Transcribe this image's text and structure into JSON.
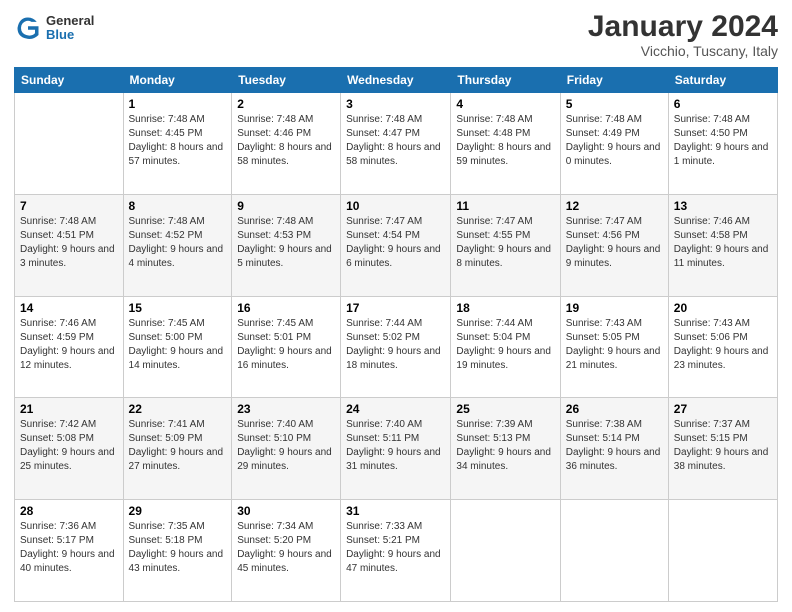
{
  "header": {
    "logo": {
      "general": "General",
      "blue": "Blue"
    },
    "title": "January 2024",
    "location": "Vicchio, Tuscany, Italy"
  },
  "weekdays": [
    "Sunday",
    "Monday",
    "Tuesday",
    "Wednesday",
    "Thursday",
    "Friday",
    "Saturday"
  ],
  "weeks": [
    [
      {
        "day": "",
        "sunrise": "",
        "sunset": "",
        "daylight": ""
      },
      {
        "day": "1",
        "sunrise": "Sunrise: 7:48 AM",
        "sunset": "Sunset: 4:45 PM",
        "daylight": "Daylight: 8 hours and 57 minutes."
      },
      {
        "day": "2",
        "sunrise": "Sunrise: 7:48 AM",
        "sunset": "Sunset: 4:46 PM",
        "daylight": "Daylight: 8 hours and 58 minutes."
      },
      {
        "day": "3",
        "sunrise": "Sunrise: 7:48 AM",
        "sunset": "Sunset: 4:47 PM",
        "daylight": "Daylight: 8 hours and 58 minutes."
      },
      {
        "day": "4",
        "sunrise": "Sunrise: 7:48 AM",
        "sunset": "Sunset: 4:48 PM",
        "daylight": "Daylight: 8 hours and 59 minutes."
      },
      {
        "day": "5",
        "sunrise": "Sunrise: 7:48 AM",
        "sunset": "Sunset: 4:49 PM",
        "daylight": "Daylight: 9 hours and 0 minutes."
      },
      {
        "day": "6",
        "sunrise": "Sunrise: 7:48 AM",
        "sunset": "Sunset: 4:50 PM",
        "daylight": "Daylight: 9 hours and 1 minute."
      }
    ],
    [
      {
        "day": "7",
        "sunrise": "Sunrise: 7:48 AM",
        "sunset": "Sunset: 4:51 PM",
        "daylight": "Daylight: 9 hours and 3 minutes."
      },
      {
        "day": "8",
        "sunrise": "Sunrise: 7:48 AM",
        "sunset": "Sunset: 4:52 PM",
        "daylight": "Daylight: 9 hours and 4 minutes."
      },
      {
        "day": "9",
        "sunrise": "Sunrise: 7:48 AM",
        "sunset": "Sunset: 4:53 PM",
        "daylight": "Daylight: 9 hours and 5 minutes."
      },
      {
        "day": "10",
        "sunrise": "Sunrise: 7:47 AM",
        "sunset": "Sunset: 4:54 PM",
        "daylight": "Daylight: 9 hours and 6 minutes."
      },
      {
        "day": "11",
        "sunrise": "Sunrise: 7:47 AM",
        "sunset": "Sunset: 4:55 PM",
        "daylight": "Daylight: 9 hours and 8 minutes."
      },
      {
        "day": "12",
        "sunrise": "Sunrise: 7:47 AM",
        "sunset": "Sunset: 4:56 PM",
        "daylight": "Daylight: 9 hours and 9 minutes."
      },
      {
        "day": "13",
        "sunrise": "Sunrise: 7:46 AM",
        "sunset": "Sunset: 4:58 PM",
        "daylight": "Daylight: 9 hours and 11 minutes."
      }
    ],
    [
      {
        "day": "14",
        "sunrise": "Sunrise: 7:46 AM",
        "sunset": "Sunset: 4:59 PM",
        "daylight": "Daylight: 9 hours and 12 minutes."
      },
      {
        "day": "15",
        "sunrise": "Sunrise: 7:45 AM",
        "sunset": "Sunset: 5:00 PM",
        "daylight": "Daylight: 9 hours and 14 minutes."
      },
      {
        "day": "16",
        "sunrise": "Sunrise: 7:45 AM",
        "sunset": "Sunset: 5:01 PM",
        "daylight": "Daylight: 9 hours and 16 minutes."
      },
      {
        "day": "17",
        "sunrise": "Sunrise: 7:44 AM",
        "sunset": "Sunset: 5:02 PM",
        "daylight": "Daylight: 9 hours and 18 minutes."
      },
      {
        "day": "18",
        "sunrise": "Sunrise: 7:44 AM",
        "sunset": "Sunset: 5:04 PM",
        "daylight": "Daylight: 9 hours and 19 minutes."
      },
      {
        "day": "19",
        "sunrise": "Sunrise: 7:43 AM",
        "sunset": "Sunset: 5:05 PM",
        "daylight": "Daylight: 9 hours and 21 minutes."
      },
      {
        "day": "20",
        "sunrise": "Sunrise: 7:43 AM",
        "sunset": "Sunset: 5:06 PM",
        "daylight": "Daylight: 9 hours and 23 minutes."
      }
    ],
    [
      {
        "day": "21",
        "sunrise": "Sunrise: 7:42 AM",
        "sunset": "Sunset: 5:08 PM",
        "daylight": "Daylight: 9 hours and 25 minutes."
      },
      {
        "day": "22",
        "sunrise": "Sunrise: 7:41 AM",
        "sunset": "Sunset: 5:09 PM",
        "daylight": "Daylight: 9 hours and 27 minutes."
      },
      {
        "day": "23",
        "sunrise": "Sunrise: 7:40 AM",
        "sunset": "Sunset: 5:10 PM",
        "daylight": "Daylight: 9 hours and 29 minutes."
      },
      {
        "day": "24",
        "sunrise": "Sunrise: 7:40 AM",
        "sunset": "Sunset: 5:11 PM",
        "daylight": "Daylight: 9 hours and 31 minutes."
      },
      {
        "day": "25",
        "sunrise": "Sunrise: 7:39 AM",
        "sunset": "Sunset: 5:13 PM",
        "daylight": "Daylight: 9 hours and 34 minutes."
      },
      {
        "day": "26",
        "sunrise": "Sunrise: 7:38 AM",
        "sunset": "Sunset: 5:14 PM",
        "daylight": "Daylight: 9 hours and 36 minutes."
      },
      {
        "day": "27",
        "sunrise": "Sunrise: 7:37 AM",
        "sunset": "Sunset: 5:15 PM",
        "daylight": "Daylight: 9 hours and 38 minutes."
      }
    ],
    [
      {
        "day": "28",
        "sunrise": "Sunrise: 7:36 AM",
        "sunset": "Sunset: 5:17 PM",
        "daylight": "Daylight: 9 hours and 40 minutes."
      },
      {
        "day": "29",
        "sunrise": "Sunrise: 7:35 AM",
        "sunset": "Sunset: 5:18 PM",
        "daylight": "Daylight: 9 hours and 43 minutes."
      },
      {
        "day": "30",
        "sunrise": "Sunrise: 7:34 AM",
        "sunset": "Sunset: 5:20 PM",
        "daylight": "Daylight: 9 hours and 45 minutes."
      },
      {
        "day": "31",
        "sunrise": "Sunrise: 7:33 AM",
        "sunset": "Sunset: 5:21 PM",
        "daylight": "Daylight: 9 hours and 47 minutes."
      },
      {
        "day": "",
        "sunrise": "",
        "sunset": "",
        "daylight": ""
      },
      {
        "day": "",
        "sunrise": "",
        "sunset": "",
        "daylight": ""
      },
      {
        "day": "",
        "sunrise": "",
        "sunset": "",
        "daylight": ""
      }
    ]
  ]
}
